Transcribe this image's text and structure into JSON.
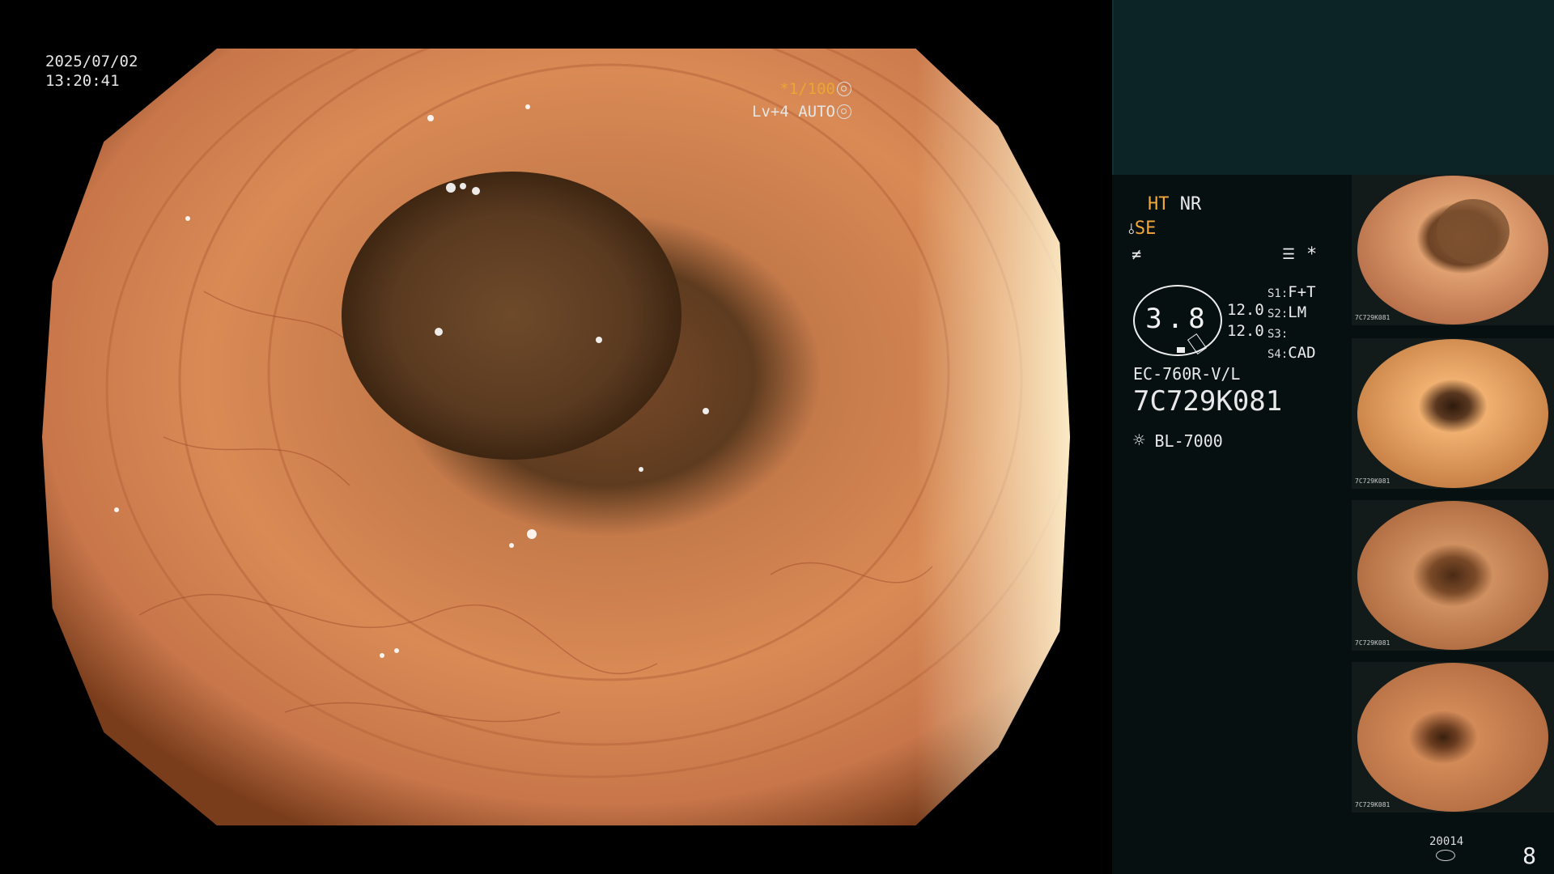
{
  "main_view": {
    "date": "2025/07/02",
    "time": "13:20:41",
    "shutter": "*1/100",
    "exposure": "Lv+4 AUTO",
    "shutter_icon": "aperture-icon",
    "exposure_icon": "iris-icon"
  },
  "panel": {
    "ht": "HT",
    "nr": "NR",
    "se": "SE",
    "structure_icon": "enhancement-icon",
    "color_icon": "color-tone-icon",
    "menu_icon": "settings-list-icon",
    "star": "*",
    "gauge_value": "3.8",
    "right_values": [
      "12.0",
      "12.0"
    ],
    "slots": [
      {
        "key": "S1:",
        "value": "F+T"
      },
      {
        "key": "S2:",
        "value": "LM"
      },
      {
        "key": "S3:",
        "value": ""
      },
      {
        "key": "S4:",
        "value": "CAD"
      }
    ],
    "scope_model": "EC-760R-V/L",
    "serial": "7C729K081",
    "light_icon": "light-source-icon",
    "light_source": "BL-7000",
    "record_id": "20014",
    "record_icon": "storage-disk-icon",
    "capture_count": "8"
  },
  "thumbnails": [
    {
      "label": "7C729K081"
    },
    {
      "label": "7C729K081"
    },
    {
      "label": "7C729K081"
    },
    {
      "label": "7C729K081"
    }
  ],
  "colors": {
    "accent_orange": "#f1a73a",
    "panel_bg": "#071011",
    "panel_top_bg": "#0c2426"
  }
}
